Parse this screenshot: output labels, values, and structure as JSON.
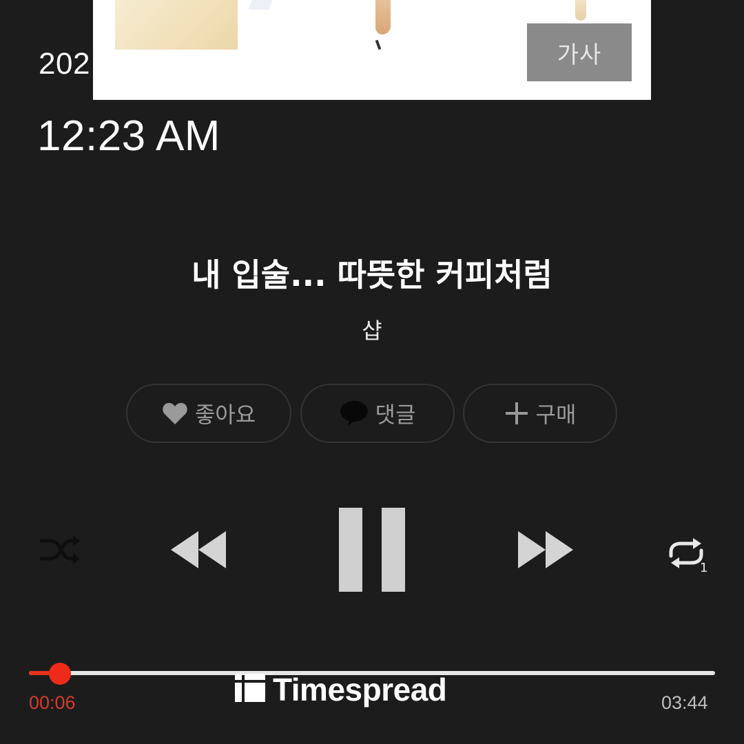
{
  "overlay": {
    "date_partial": "202",
    "time": "12:23 AM"
  },
  "album": {
    "lyrics_label": "가사"
  },
  "song": {
    "title": "내 입술... 따뜻한 커피처럼",
    "artist": "샵"
  },
  "actions": {
    "like_label": "좋아요",
    "comment_label": "댓글",
    "buy_label": "구매"
  },
  "controls": {
    "shuffle_icon": "shuffle-icon",
    "rewind_icon": "rewind-icon",
    "pause_icon": "pause-icon",
    "forward_icon": "fast-forward-icon",
    "repeat_icon": "repeat-one-icon",
    "repeat_count": "1"
  },
  "progress": {
    "elapsed": "00:06",
    "total": "03:44",
    "fraction": 0.045
  },
  "watermark": {
    "text": "Timespread"
  },
  "colors": {
    "background": "#1c1c1c",
    "accent": "#ee2a18",
    "muted": "#9a9a9a"
  }
}
